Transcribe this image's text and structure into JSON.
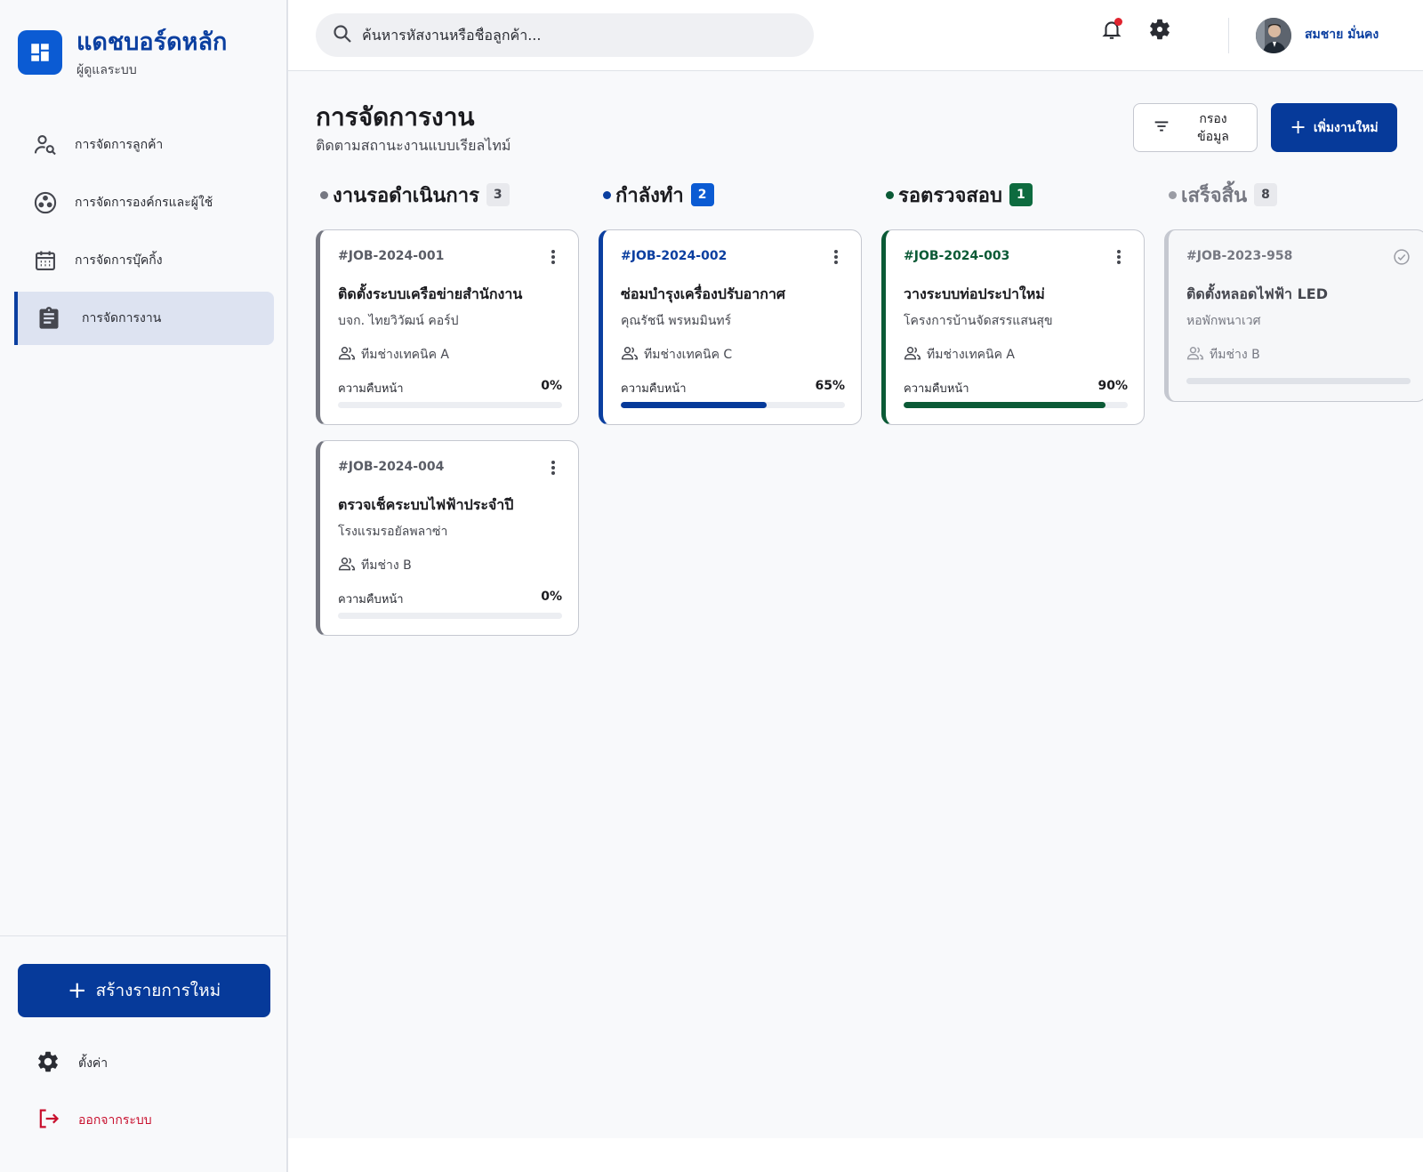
{
  "brand": {
    "title": "แดชบอร์ดหลัก",
    "subtitle": "ผู้ดูแลระบบ"
  },
  "sidebar": {
    "items": [
      {
        "label": "การจัดการลูกค้า",
        "icon": "user-search-icon",
        "active": false
      },
      {
        "label": "การจัดการองค์กรและผู้ใช้",
        "icon": "organization-icon",
        "active": false
      },
      {
        "label": "การจัดการบุ๊คกิ้ง",
        "icon": "calendar-icon",
        "active": false
      },
      {
        "label": "การจัดการงาน",
        "icon": "clipboard-icon",
        "active": true
      }
    ],
    "create_label": "สร้างรายการใหม่",
    "settings_label": "ตั้งค่า",
    "logout_label": "ออกจากระบบ"
  },
  "topbar": {
    "search_placeholder": "ค้นหารหัสงานหรือชื่อลูกค้า...",
    "user_name": "สมชาย มั่นคง",
    "has_notification": true
  },
  "page": {
    "title": "การจัดการงาน",
    "subtitle": "ติดตามสถานะงานแบบเรียลไทม์",
    "filter_label_line1": "กรอง",
    "filter_label_line2": "ข้อมูล",
    "add_label": "เพิ่มงานใหม่"
  },
  "colors": {
    "primary": "#063a9a",
    "pending": "#767882",
    "in_progress": "#0b3fa0",
    "review": "#0b5a36",
    "done": "#9a9ca4",
    "notification": "#e0242f"
  },
  "columns": [
    {
      "title": "งานรอดำเนินการ",
      "count": "3",
      "cards": [
        {
          "id": "#JOB-2024-001",
          "title": "ติดตั้งระบบเครือข่ายสำนักงาน",
          "client": "บจก. ไทยวิวัฒน์ คอร์ป",
          "team": "ทีมช่างเทคนิค A",
          "progress_label": "ความคืบหน้า",
          "progress_text": "0%",
          "progress": 0
        },
        {
          "id": "#JOB-2024-004",
          "title": "ตรวจเช็คระบบไฟฟ้าประจำปี",
          "client": "โรงแรมรอยัลพลาซ่า",
          "team": "ทีมช่าง B",
          "progress_label": "ความคืบหน้า",
          "progress_text": "0%",
          "progress": 0
        }
      ]
    },
    {
      "title": "กำลังทำ",
      "count": "2",
      "cards": [
        {
          "id": "#JOB-2024-002",
          "title": "ซ่อมบำรุงเครื่องปรับอากาศ",
          "client": "คุณรัชนี พรหมมินทร์",
          "team": "ทีมช่างเทคนิค C",
          "progress_label": "ความคืบหน้า",
          "progress_text": "65%",
          "progress": 65
        }
      ]
    },
    {
      "title": "รอตรวจสอบ",
      "count": "1",
      "cards": [
        {
          "id": "#JOB-2024-003",
          "title": "วางระบบท่อประปาใหม่",
          "client": "โครงการบ้านจัดสรรแสนสุข",
          "team": "ทีมช่างเทคนิค A",
          "progress_label": "ความคืบหน้า",
          "progress_text": "90%",
          "progress": 90
        }
      ]
    },
    {
      "title": "เสร็จสิ้น",
      "count": "8",
      "cards": [
        {
          "id": "#JOB-2023-958",
          "title": "ติดตั้งหลอดไฟฟ้า LED",
          "client": "หอพักพนาเวศ",
          "team": "ทีมช่าง B",
          "progress": 100
        }
      ]
    }
  ]
}
